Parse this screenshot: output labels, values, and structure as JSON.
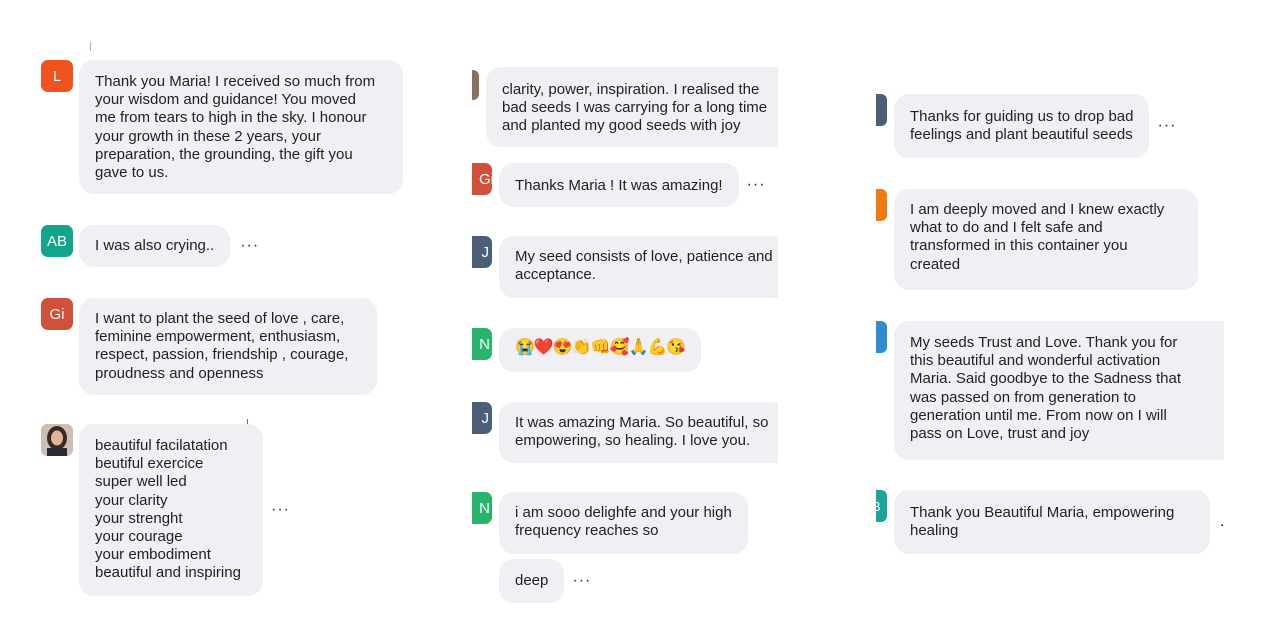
{
  "colors": {
    "bubble": "#efeff4",
    "avatar_L": "#f0531f",
    "avatar_AB": "#12a58a",
    "avatar_Gi": "#d0503a",
    "avatar_J": "#4b5f78",
    "avatar_N": "#28b46c",
    "avatar_orange": "#f07a10",
    "avatar_blue": "#2e8ccf",
    "avatar_teal": "#19a59a"
  },
  "col1": {
    "m1": {
      "initial": "L",
      "text": "Thank you Maria! I received so much from\nyour wisdom and guidance! You moved\nme from tears to high in the sky. I honour\nyour growth in these 2 years, your\npreparation, the grounding, the gift you\ngave to us."
    },
    "m2": {
      "initial": "AB",
      "text": "I was also crying..",
      "more": "···"
    },
    "m3": {
      "initial": "Gi",
      "text": "I want to plant the seed of love , care,\nfeminine empowerment, enthusiasm,\nrespect, passion, friendship , courage,\nproudness and openness"
    },
    "m4": {
      "text": "beautiful facilatation\nbeutiful exercice\nsuper well led\nyour clarity\nyour strenght\nyour courage\nyour embodiment\nbeautiful and inspiring",
      "more": "···"
    }
  },
  "col2": {
    "m1": {
      "text": "clarity, power, inspiration. I realised the\nbad seeds I was carrying for a long time\nand planted my good seeds with joy"
    },
    "m2": {
      "initial": "Gi",
      "text": "Thanks Maria ! It was amazing!",
      "more": "···"
    },
    "m3": {
      "initial": "J",
      "text": "My seed consists of love, patience and\nacceptance."
    },
    "m4": {
      "initial": "N",
      "text": "😭❤️😍👏👊🥰🙏💪😘"
    },
    "m5": {
      "initial": "J",
      "text": "It was amazing Maria. So beautiful, so\nempowering, so healing. I love you."
    },
    "m6": {
      "initial": "N",
      "text": "i am sooo delighfe and your high\nfrequency reaches so"
    },
    "m7": {
      "text": "deep",
      "more": "···"
    }
  },
  "col3": {
    "m1": {
      "text": "Thanks for guiding us to drop bad\nfeelings and plant beautiful seeds",
      "more": "···"
    },
    "m2": {
      "text": "I am deeply moved and I knew exactly\nwhat to do and I felt safe and\ntransformed in this container you\ncreated"
    },
    "m3": {
      "text": "My seeds Trust and Love. Thank you for\nthis beautiful and wonderful activation\nMaria. Said goodbye to the Sadness that\nwas passed on from generation to\ngeneration until me. From now on I will\npass on Love, trust and joy"
    },
    "m4": {
      "initial": "B",
      "text": "Thank you Beautiful Maria, empowering\nhealing",
      "dot": "."
    }
  }
}
